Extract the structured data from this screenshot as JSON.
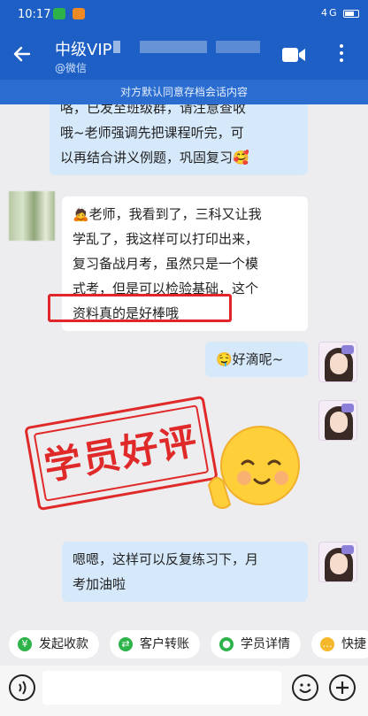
{
  "status_bar": {
    "time": "10:17",
    "right_text": "4G"
  },
  "header": {
    "title": "中级VIP",
    "subtitle": "@微信"
  },
  "notice": "对方默认同意存档会话内容",
  "messages": {
    "m1": [
      "咯，已发至班级群，请注意查收",
      "哦~老师强调先把课程听完，可",
      "以再结合讲义例题，巩固复习🥰"
    ],
    "m2": [
      "🙇老师，我看到了，三科又让我",
      "学乱了，我这样可以打印出来，",
      "复习备战月考，虽然只是一个模",
      "式考，但是可以检验基础，这个",
      "资料真的是好棒哦"
    ],
    "m3": "🤤好滴呢~",
    "m4": [
      "嗯嗯，这样可以反复练习下，月",
      "考加油啦"
    ]
  },
  "stamp_text": "学员好评",
  "quick_actions": [
    "发起收款",
    "客户转账",
    "学员详情",
    "快捷"
  ],
  "colors": {
    "brand": "#1d5fc4",
    "stamp": "#e02a2a",
    "bubble_right": "#d6e9fb"
  }
}
